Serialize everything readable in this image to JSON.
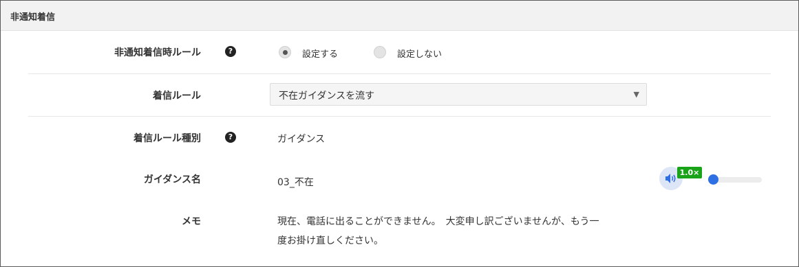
{
  "panel": {
    "title": "非通知着信"
  },
  "rows": {
    "rule_toggle": {
      "label": "非通知着信時ルール",
      "help_icon": "?",
      "options": [
        "設定する",
        "設定しない"
      ],
      "selected": "設定する"
    },
    "incoming_rule": {
      "label": "着信ルール",
      "value": "不在ガイダンスを流す",
      "arrow": "▼"
    },
    "rule_type": {
      "label": "着信ルール種別",
      "help_icon": "?",
      "value": "ガイダンス"
    },
    "guidance_name": {
      "label": "ガイダンス名",
      "value": "03_不在",
      "player": {
        "icon": "speaker-icon",
        "speed": "1.0×",
        "progress": 0
      }
    },
    "memo": {
      "label": "メモ",
      "lines": [
        "現在、電話に出ることができません。　大変申し訳ございませんが、もう一",
        "度お掛け直しください。"
      ]
    }
  },
  "colors": {
    "header_bg": "#f2f2f2",
    "accent_blue": "#2f6fe4",
    "speed_badge": "#19a319"
  }
}
